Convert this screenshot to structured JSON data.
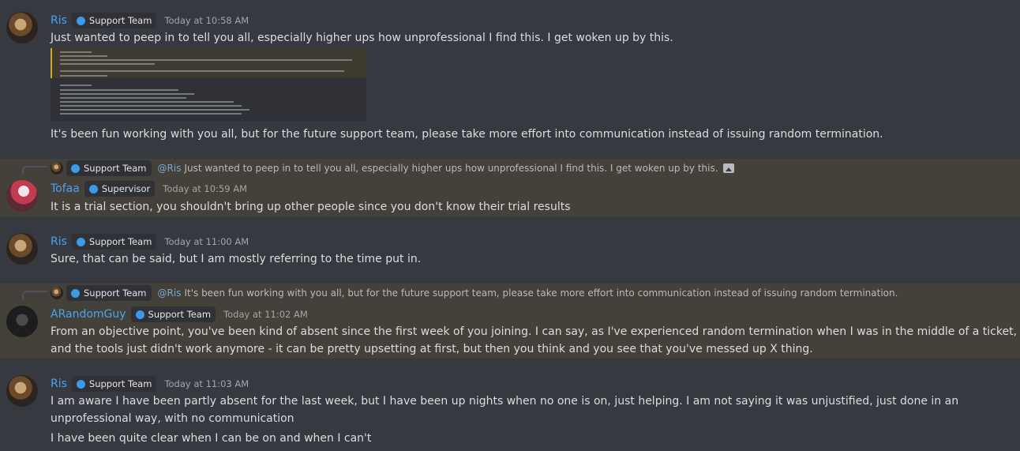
{
  "colors": {
    "background": "#36393f",
    "highlight": "#44403a",
    "username": "#4aa3f0",
    "role_dot": "#3b9be8",
    "mention": "#7ba7d6"
  },
  "messages": [
    {
      "author": "Ris",
      "role": "Support Team",
      "time": "Today at 10:58 AM",
      "lines": [
        "Just wanted to peep in to tell you all, especially higher ups how unprofessional I find this. I get woken up by this."
      ],
      "attachment": "screenshot-image",
      "after": "It's been fun working with you all, but for the future support team, please take more effort into communication instead of issuing random termination."
    },
    {
      "reply": {
        "role": "Support Team",
        "mention": "@Ris",
        "text": "Just wanted to peep in to tell you all, especially higher ups how unprofessional I find this. I get woken up by this.",
        "icon": "image-icon"
      },
      "author": "Tofaa",
      "role": "Supervisor",
      "time": "Today at 10:59 AM",
      "lines": [
        "It is a trial section, you shouldn't bring up other people since you don't know their trial results"
      ]
    },
    {
      "author": "Ris",
      "role": "Support Team",
      "time": "Today at 11:00 AM",
      "lines": [
        "Sure, that can be said, but I am mostly referring to the time put in."
      ]
    },
    {
      "reply": {
        "role": "Support Team",
        "mention": "@Ris",
        "text": "It's been fun working with you all, but for the future support team, please take more effort into communication instead of issuing random termination."
      },
      "author": "ARandomGuy",
      "role": "Support Team",
      "time": "Today at 11:02 AM",
      "lines": [
        "From an objective point, you've been kind of absent since the first week of you joining. I can say, as I've experienced random termination when I was in the middle of a ticket, and the tools just didn't work anymore - it can be pretty upsetting at first, but then you think and you see that you've messed up X thing."
      ]
    },
    {
      "author": "Ris",
      "role": "Support Team",
      "time": "Today at 11:03 AM",
      "lines": [
        "I am aware I have been partly absent for the last week, but I have been up nights when no one is on, just helping. I am not saying it was unjustified, just done in an unprofessional way, with no communication",
        "I have been quite clear when I can be on and when I can't"
      ]
    }
  ]
}
